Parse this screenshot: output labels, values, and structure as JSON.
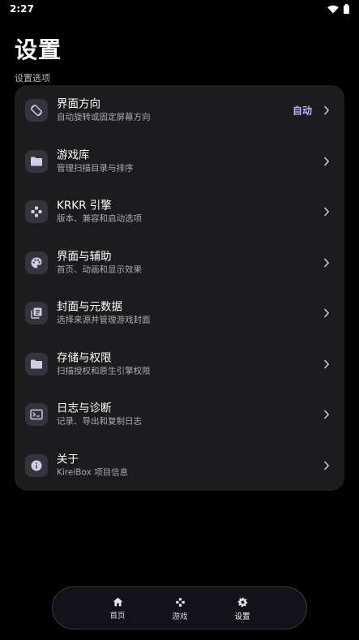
{
  "status_bar": {
    "time": "2:27"
  },
  "page": {
    "title": "设置",
    "section_label": "设置选项"
  },
  "colors": {
    "accent": "#b7b2ff",
    "card": "#1c1c1f",
    "icon_bg": "#34343c"
  },
  "settings": [
    {
      "icon": "screen-rotation-icon",
      "title": "界面方向",
      "subtitle": "自动旋转或固定屏幕方向",
      "value": "自动"
    },
    {
      "icon": "folder-icon",
      "title": "游戏库",
      "subtitle": "管理扫描目录与排序"
    },
    {
      "icon": "gamepad-icon",
      "title": "KRKR 引擎",
      "subtitle": "版本、兼容和启动选项"
    },
    {
      "icon": "palette-icon",
      "title": "界面与辅助",
      "subtitle": "首页、动画和显示效果"
    },
    {
      "icon": "library-icon",
      "title": "封面与元数据",
      "subtitle": "选择来源并管理游戏封面"
    },
    {
      "icon": "folder-icon",
      "title": "存储与权限",
      "subtitle": "扫描授权和原生引擎权限"
    },
    {
      "icon": "terminal-icon",
      "title": "日志与诊断",
      "subtitle": "记录、导出和复制日志"
    },
    {
      "icon": "info-icon",
      "title": "关于",
      "subtitle": "KireiBox 项目信息"
    }
  ],
  "bottom_nav": {
    "items": [
      {
        "icon": "home-icon",
        "label": "首页"
      },
      {
        "icon": "gamepad-icon",
        "label": "游戏"
      },
      {
        "icon": "gear-icon",
        "label": "设置",
        "active": true
      }
    ]
  }
}
